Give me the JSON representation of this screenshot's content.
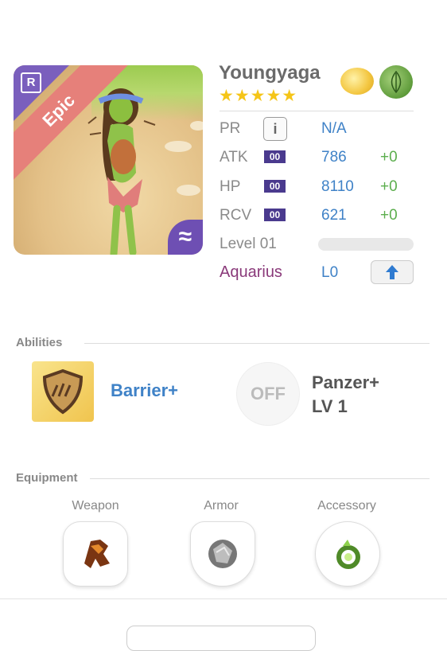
{
  "character": {
    "name": "Youngyaga",
    "rarity_label": "Epic",
    "rarity_icon_text": "R",
    "stars": "★★★★★",
    "star_count": 5,
    "element_icons": [
      "cloud-icon",
      "leaf-icon"
    ],
    "attribute_badge": "≈"
  },
  "stats": {
    "pr": {
      "label": "PR",
      "info": "i",
      "value": "N/A"
    },
    "atk": {
      "label": "ATK",
      "badge": "00",
      "value": "786",
      "plus": "+0"
    },
    "hp": {
      "label": "HP",
      "badge": "00",
      "value": "8110",
      "plus": "+0"
    },
    "rcv": {
      "label": "RCV",
      "badge": "00",
      "value": "621",
      "plus": "+0"
    },
    "level": {
      "label": "Level 01",
      "progress": 0
    },
    "sign": {
      "label": "Aquarius",
      "value": "L0"
    }
  },
  "abilities": {
    "title": "Abilities",
    "items": [
      {
        "name": "Barrier+",
        "icon": "shield-icon"
      },
      {
        "name": "Panzer+",
        "level": "LV 1",
        "state": "OFF",
        "icon": "shield-off-icon"
      }
    ]
  },
  "equipment": {
    "title": "Equipment",
    "slots": [
      {
        "label": "Weapon",
        "icon": "weapon-icon"
      },
      {
        "label": "Armor",
        "icon": "armor-orb-icon"
      },
      {
        "label": "Accessory",
        "icon": "accessory-ring-icon"
      }
    ]
  },
  "colors": {
    "epic_band": "#e6807a",
    "rarity_corner": "#7a5fbd",
    "value_blue": "#3f82c7",
    "plus_green": "#5cae4e",
    "aquarius": "#8a3a7a",
    "star": "#f5c518"
  }
}
